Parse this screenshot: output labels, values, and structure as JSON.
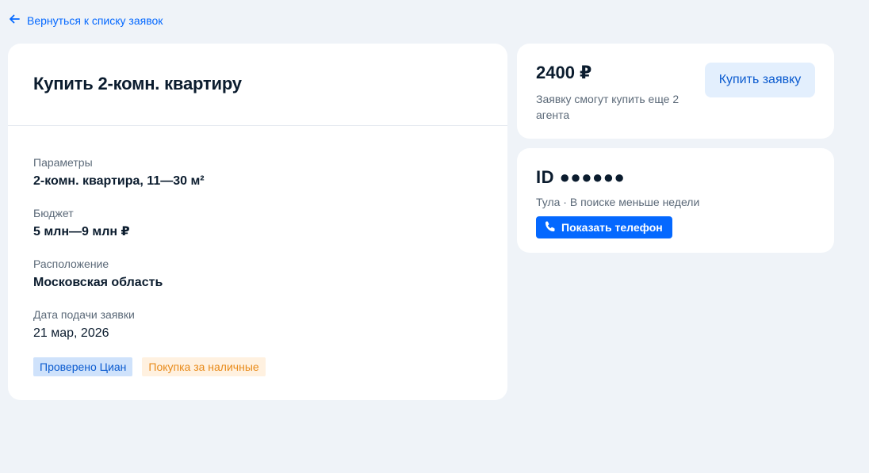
{
  "back_link": {
    "label": "Вернуться к списку заявок",
    "icon": "arrow-left-icon"
  },
  "request": {
    "title": "Купить 2-комн. квартиру",
    "fields": [
      {
        "label": "Параметры",
        "value": "2-комн. квартира, 11—30 м²"
      },
      {
        "label": "Бюджет",
        "value": "5 млн—9 млн ₽"
      },
      {
        "label": "Расположение",
        "value": "Московская область"
      },
      {
        "label": "Дата подачи заявки",
        "value": "21 мар, 2026"
      }
    ],
    "tags": [
      {
        "label": "Проверено Циан",
        "color": "#0b5bcf"
      },
      {
        "label": "Покупка за наличные",
        "color": "#e88a19"
      }
    ]
  },
  "purchase": {
    "price": "2400 ₽",
    "note": "Заявку смогут купить еще 2 агента",
    "button_label": "Купить заявку"
  },
  "contact": {
    "id": "ID ●●●●●●",
    "meta": "Тула · В поиске меньше недели",
    "phone_button_label": "Показать телефон",
    "phone_icon": "phone-icon"
  },
  "colors": {
    "accent": "#0468ff",
    "background": "#eff3f8"
  }
}
